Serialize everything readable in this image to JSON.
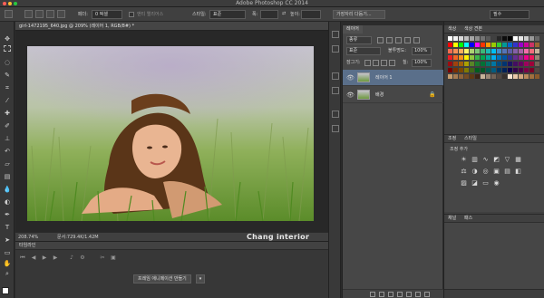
{
  "window": {
    "title": "Adobe Photoshop CC 2014"
  },
  "options_bar": {
    "feather_label": "페더:",
    "feather_value": "0 픽셀",
    "antialias_label": "앤티 앨리어스",
    "style_label": "스타일:",
    "style_value": "표준",
    "width_label": "폭:",
    "height_label": "높이:",
    "refine_edge_button": "가장자리 다듬기...",
    "workspace_value": "필수"
  },
  "document": {
    "tab_label": "girl-1472195_640.jpg @ 209% (레이어 1, RGB/8#) *",
    "zoom": "208.74%",
    "doc_size": "문서:729.4K/1.42M",
    "watermark": "Chang interior"
  },
  "timeline": {
    "tab_label": "타임라인",
    "create_button": "프레임 애니메이션 만들기",
    "dropdown_glyph": "▾"
  },
  "layers_panel": {
    "tab_label": "레이어",
    "kind_value": "종류",
    "blend_value": "표준",
    "opacity_label": "불투명도:",
    "opacity_value": "100%",
    "lock_label": "잠그기:",
    "fill_label": "칠:",
    "fill_value": "100%",
    "layers": [
      {
        "name": "레이어 1",
        "selected": true,
        "locked": false
      },
      {
        "name": "배경",
        "selected": false,
        "locked": true
      }
    ]
  },
  "swatches_panel": {
    "tab_color": "색상",
    "tab_swatches": "색상 견본",
    "colors": [
      [
        "#ffffff",
        "#f2f2f2",
        "#d9d9d9",
        "#bfbfbf",
        "#a6a6a6",
        "#8c8c8c",
        "#737373",
        "#595959",
        "#404040",
        "#262626",
        "#0d0d0d",
        "#000000",
        "#ffffff",
        "#e6e6e6",
        "#cccccc",
        "#999999",
        "#666666"
      ],
      [
        "#ff0000",
        "#ffff00",
        "#00ff00",
        "#00ffff",
        "#0000ff",
        "#ff00ff",
        "#ff3300",
        "#ff9900",
        "#99cc00",
        "#33cc33",
        "#009999",
        "#0066cc",
        "#3333cc",
        "#9900cc",
        "#cc0099",
        "#cc3366",
        "#996633"
      ],
      [
        "#f26c4f",
        "#f68e55",
        "#fbaf5c",
        "#fff467",
        "#acd372",
        "#7cc576",
        "#3bb878",
        "#1abbb4",
        "#00bff3",
        "#438cca",
        "#5574b9",
        "#605ca8",
        "#855fa8",
        "#a763a8",
        "#f06ea9",
        "#f26d7d",
        "#c7b299"
      ],
      [
        "#ed1c24",
        "#f26522",
        "#f7941d",
        "#fff200",
        "#8dc63f",
        "#39b54a",
        "#00a651",
        "#00a99d",
        "#00aeef",
        "#0072bc",
        "#0054a6",
        "#2e3192",
        "#662d91",
        "#92278f",
        "#ec008c",
        "#ed145b",
        "#998675"
      ],
      [
        "#9e0b0f",
        "#a0410d",
        "#a36209",
        "#aba000",
        "#598527",
        "#1a7b30",
        "#007236",
        "#00746b",
        "#0076a3",
        "#004b80",
        "#003471",
        "#1b1464",
        "#440e62",
        "#630460",
        "#9e005d",
        "#9e0039",
        "#736357"
      ],
      [
        "#790000",
        "#7b2e00",
        "#7d4900",
        "#827b00",
        "#406618",
        "#005e20",
        "#005826",
        "#005952",
        "#005b7f",
        "#003663",
        "#002157",
        "#0d004c",
        "#32004b",
        "#4b0049",
        "#7b0046",
        "#7a0026",
        "#534741"
      ],
      [
        "#c69c6d",
        "#a67c52",
        "#8c6239",
        "#754c24",
        "#603913",
        "#3c2415",
        "#c7b299",
        "#998675",
        "#736357",
        "#534741",
        "#37302d",
        "#f7e4d2",
        "#e8c8a8",
        "#d2a77f",
        "#b9895b",
        "#a06f3e",
        "#8a5a2b"
      ]
    ]
  },
  "adjustments_panel": {
    "tab_adjustments": "조정",
    "tab_styles": "스타일",
    "title": "조정 추가",
    "icons": [
      "brightness-icon",
      "levels-icon",
      "curves-icon",
      "exposure-icon",
      "vibrance-icon",
      "hue-saturation-icon",
      "color-balance-icon",
      "black-white-icon",
      "photo-filter-icon",
      "channel-mixer-icon",
      "color-lookup-icon",
      "invert-icon",
      "posterize-icon",
      "threshold-icon",
      "gradient-map-icon",
      "selective-color-icon"
    ]
  },
  "paths_panel": {
    "tab_channels": "채널",
    "tab_paths": "패스"
  },
  "colors": {
    "accent_selected": "#5a6f8a",
    "panel_bg": "#474747",
    "grass": "#6d9a3e"
  }
}
